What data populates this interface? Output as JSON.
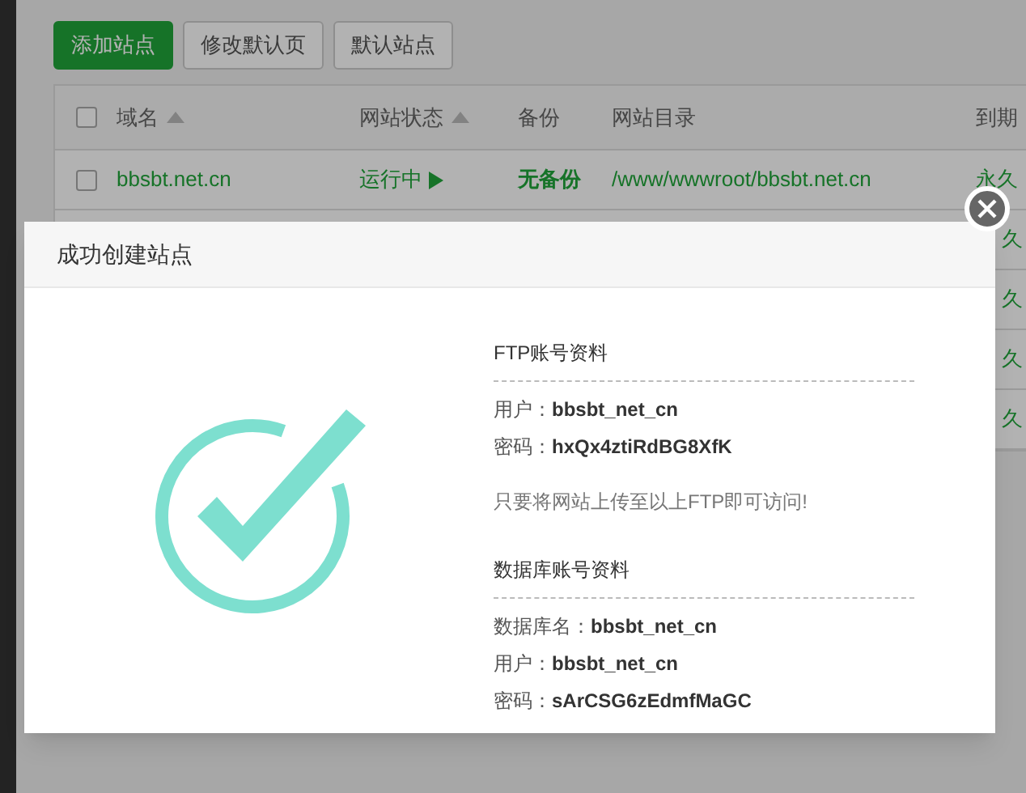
{
  "toolbar": {
    "buttons": [
      {
        "label": "添加站点",
        "kind": "primary"
      },
      {
        "label": "修改默认页",
        "kind": "default"
      },
      {
        "label": "默认站点",
        "kind": "default"
      }
    ]
  },
  "table": {
    "checked_all": false,
    "columns": [
      {
        "label": "域名",
        "sortable": true
      },
      {
        "label": "网站状态",
        "sortable": true
      },
      {
        "label": "备份",
        "sortable": false
      },
      {
        "label": "网站目录",
        "sortable": false
      },
      {
        "label": "到期",
        "sortable": false
      }
    ],
    "rows": [
      {
        "checked": false,
        "domain": "bbsbt.net.cn",
        "status": "运行中",
        "backup": "无备份",
        "path": "/www/wwwroot/bbsbt.net.cn",
        "expiry": "永久"
      },
      {
        "expiry": "久"
      },
      {
        "expiry": "久"
      },
      {
        "expiry": "久"
      },
      {
        "expiry": "久"
      }
    ]
  },
  "dialog": {
    "title": "成功创建站点",
    "ftp": {
      "heading": "FTP账号资料",
      "fields": [
        {
          "label": "用户：",
          "value": "bbsbt_net_cn"
        },
        {
          "label": "密码：",
          "value": "hxQx4ztiRdBG8XfK"
        }
      ],
      "note": "只要将网站上传至以上FTP即可访问!"
    },
    "database": {
      "heading": "数据库账号资料",
      "fields": [
        {
          "label": "数据库名：",
          "value": "bbsbt_net_cn"
        },
        {
          "label": "用户：",
          "value": "bbsbt_net_cn"
        },
        {
          "label": "密码：",
          "value": "sArCSG6zEdmfMaGC"
        }
      ]
    }
  }
}
